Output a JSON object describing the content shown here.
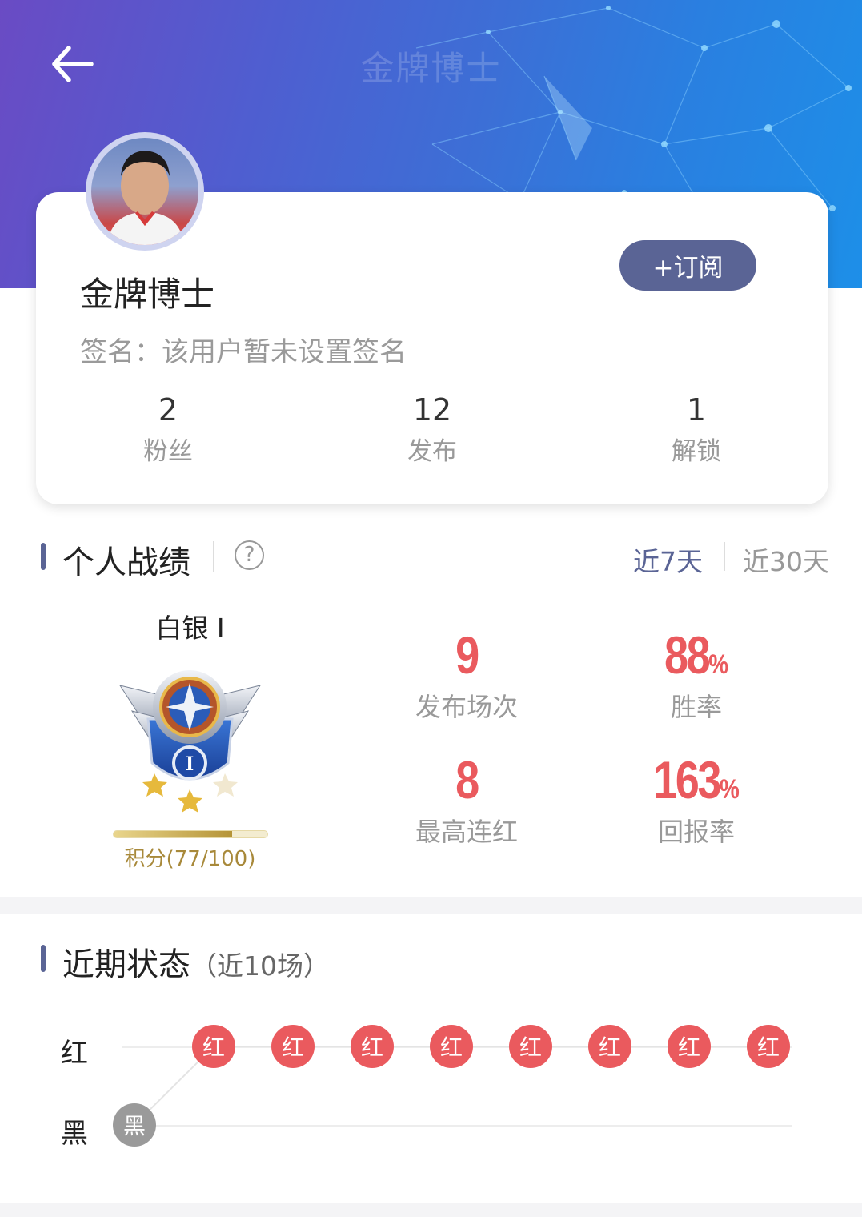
{
  "header": {
    "watermark_title": "金牌博士",
    "back_icon": "arrow-left-icon"
  },
  "profile": {
    "name": "金牌博士",
    "signature": "签名：该用户暂未设置签名",
    "subscribe_label": "+订阅",
    "stats": [
      {
        "value": "2",
        "label": "粉丝"
      },
      {
        "value": "12",
        "label": "发布"
      },
      {
        "value": "1",
        "label": "解锁"
      }
    ]
  },
  "record": {
    "title": "个人战绩",
    "help_glyph": "?",
    "tabs": [
      {
        "label": "近7天",
        "active": true
      },
      {
        "label": "近30天",
        "active": false
      }
    ],
    "rank": {
      "name": "白银 I",
      "badge_numeral": "I",
      "points_text": "积分(77/100)",
      "points": 77,
      "points_max": 100
    },
    "metrics": [
      {
        "value": "9",
        "unit": "",
        "label": "发布场次"
      },
      {
        "value": "88",
        "unit": "%",
        "label": "胜率"
      },
      {
        "value": "8",
        "unit": "",
        "label": "最高连红"
      },
      {
        "value": "163",
        "unit": "%",
        "label": "回报率"
      }
    ]
  },
  "recent": {
    "title": "近期状态",
    "subtitle": "（近10场）",
    "row_labels": {
      "red": "红",
      "black": "黑"
    },
    "results": [
      "黑",
      "红",
      "红",
      "红",
      "红",
      "红",
      "红",
      "红",
      "红"
    ]
  },
  "colors": {
    "accent": "#5a6495",
    "red": "#ea5a5e",
    "gray": "#9a9a9a",
    "gold": "#a8893a"
  }
}
